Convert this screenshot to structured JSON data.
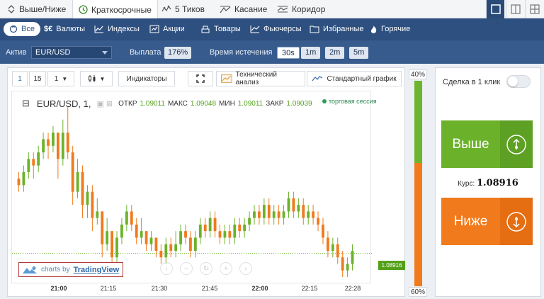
{
  "top_tabs": [
    {
      "label": "Выше/Ниже",
      "icon": "updown-icon"
    },
    {
      "label": "Краткосрочные",
      "icon": "clock-icon"
    },
    {
      "label": "5 Тиков",
      "icon": "ticks-icon"
    },
    {
      "label": "Касание",
      "icon": "touch-icon"
    },
    {
      "label": "Коридор",
      "icon": "corridor-icon"
    }
  ],
  "categories": [
    {
      "label": "Все",
      "icon": "all-icon"
    },
    {
      "label": "Валюты",
      "icon": "currency-icon"
    },
    {
      "label": "Индексы",
      "icon": "index-icon"
    },
    {
      "label": "Акции",
      "icon": "stocks-icon"
    },
    {
      "label": "Товары",
      "icon": "commodities-icon"
    },
    {
      "label": "Фьючерсы",
      "icon": "futures-icon"
    },
    {
      "label": "Избранные",
      "icon": "favorites-icon"
    },
    {
      "label": "Горячие",
      "icon": "hot-icon"
    }
  ],
  "settings": {
    "asset_label": "Актив",
    "asset_value": "EUR/USD",
    "payout_label": "Выплата",
    "payout_value": "176%",
    "expiry_label": "Время истечения",
    "expiry_options": [
      "30s",
      "1m",
      "2m",
      "5m"
    ],
    "expiry_selected": "30s"
  },
  "chart_toolbar": {
    "interval_a": "1",
    "interval_b": "15",
    "interval_c": "1",
    "indicators": "Индикаторы",
    "tech_analysis": "Технический анализ",
    "standard_chart": "Стандартный график"
  },
  "chart_legend": {
    "symbol": "EUR/USD, 1,",
    "open_label": "ОТКР",
    "open": "1.09011",
    "high_label": "МАКС",
    "high": "1.09048",
    "low_label": "МИН",
    "low": "1.09011",
    "close_label": "ЗАКР",
    "close": "1.09039",
    "session": "торговая сессия"
  },
  "current_price": "1.08916",
  "tv_badge": {
    "prefix": "charts by",
    "brand": "TradingView"
  },
  "sentiment": {
    "up_label": "40%",
    "down_label": "60%",
    "up_color": "#6db52e",
    "down_color": "#f07a1c"
  },
  "trade": {
    "one_click": "Сделка в 1 клик",
    "up_label": "Выше",
    "down_label": "Ниже",
    "rate_label": "Курс:",
    "rate_value": "1.08916"
  },
  "colors": {
    "bull": "#6bb22a",
    "bear": "#f07a1c",
    "nav": "#2e5080"
  },
  "chart_data": {
    "type": "candlestick",
    "x_ticks": [
      "21:00",
      "21:15",
      "21:30",
      "21:45",
      "22:00",
      "22:15",
      "22:28"
    ],
    "bold_ticks": [
      "21:00",
      "22:00"
    ],
    "price_range": [
      1.0888,
      1.0915
    ],
    "last_price": 1.08916,
    "candles": [
      [
        1.0903,
        1.0902,
        1.0904,
        1.0901
      ],
      [
        1.0902,
        1.0904,
        1.0905,
        1.0901
      ],
      [
        1.0904,
        1.0906,
        1.0907,
        1.0903
      ],
      [
        1.0906,
        1.0905,
        1.0907,
        1.0903
      ],
      [
        1.0905,
        1.0907,
        1.0908,
        1.0904
      ],
      [
        1.0907,
        1.0909,
        1.091,
        1.0906
      ],
      [
        1.0909,
        1.0908,
        1.091,
        1.0906
      ],
      [
        1.0908,
        1.091,
        1.0911,
        1.0907
      ],
      [
        1.091,
        1.0906,
        1.091,
        1.0903
      ],
      [
        1.0906,
        1.091,
        1.0912,
        1.0905
      ],
      [
        1.091,
        1.0907,
        1.0914,
        1.0906
      ],
      [
        1.0907,
        1.0901,
        1.0908,
        1.0899
      ],
      [
        1.0901,
        1.0904,
        1.0906,
        1.09
      ],
      [
        1.0904,
        1.0899,
        1.0905,
        1.0897
      ],
      [
        1.0899,
        1.0901,
        1.0902,
        1.0897
      ],
      [
        1.0901,
        1.0897,
        1.0902,
        1.0895
      ],
      [
        1.0897,
        1.0898,
        1.09,
        1.0896
      ],
      [
        1.0898,
        1.0893,
        1.0898,
        1.0891
      ],
      [
        1.0893,
        1.0895,
        1.0897,
        1.0892
      ],
      [
        1.0895,
        1.0891,
        1.0895,
        1.089
      ],
      [
        1.0891,
        1.0894,
        1.0895,
        1.089
      ],
      [
        1.0894,
        1.0896,
        1.0897,
        1.0893
      ],
      [
        1.0896,
        1.0898,
        1.0899,
        1.0895
      ],
      [
        1.0898,
        1.0896,
        1.0899,
        1.0895
      ],
      [
        1.0896,
        1.0894,
        1.0897,
        1.0893
      ],
      [
        1.0894,
        1.0895,
        1.0897,
        1.0893
      ],
      [
        1.0895,
        1.0893,
        1.0895,
        1.0892
      ],
      [
        1.0893,
        1.0894,
        1.0895,
        1.0892
      ],
      [
        1.0894,
        1.0892,
        1.0894,
        1.0891
      ],
      [
        1.0892,
        1.0891,
        1.0893,
        1.089
      ],
      [
        1.0891,
        1.0893,
        1.0894,
        1.089
      ],
      [
        1.0893,
        1.0892,
        1.0894,
        1.0891
      ],
      [
        1.0892,
        1.0893,
        1.0895,
        1.0891
      ],
      [
        1.0893,
        1.0895,
        1.0896,
        1.0892
      ],
      [
        1.0895,
        1.0894,
        1.0896,
        1.0893
      ],
      [
        1.0894,
        1.0892,
        1.0895,
        1.0891
      ],
      [
        1.0892,
        1.0894,
        1.0895,
        1.0891
      ],
      [
        1.0894,
        1.0896,
        1.0897,
        1.0893
      ],
      [
        1.0896,
        1.0895,
        1.0897,
        1.0894
      ],
      [
        1.0895,
        1.0897,
        1.0898,
        1.0894
      ],
      [
        1.0897,
        1.0895,
        1.0898,
        1.0894
      ],
      [
        1.0895,
        1.0894,
        1.0896,
        1.0893
      ],
      [
        1.0894,
        1.0895,
        1.0896,
        1.0893
      ],
      [
        1.0895,
        1.0894,
        1.0896,
        1.0893
      ],
      [
        1.0894,
        1.0896,
        1.0897,
        1.0893
      ],
      [
        1.0896,
        1.0895,
        1.0897,
        1.0894
      ],
      [
        1.0895,
        1.0896,
        1.0897,
        1.0894
      ],
      [
        1.0896,
        1.0897,
        1.0898,
        1.0895
      ],
      [
        1.0897,
        1.0898,
        1.0899,
        1.0896
      ],
      [
        1.0898,
        1.0897,
        1.0899,
        1.0896
      ],
      [
        1.0897,
        1.0899,
        1.09,
        1.0896
      ],
      [
        1.0899,
        1.0897,
        1.09,
        1.0896
      ],
      [
        1.0897,
        1.0898,
        1.0899,
        1.0896
      ],
      [
        1.0898,
        1.0897,
        1.0899,
        1.0896
      ],
      [
        1.0897,
        1.0898,
        1.0899,
        1.0896
      ],
      [
        1.0898,
        1.09,
        1.0901,
        1.0897
      ],
      [
        1.09,
        1.0898,
        1.0901,
        1.0897
      ],
      [
        1.0898,
        1.0899,
        1.09,
        1.0897
      ],
      [
        1.0899,
        1.0897,
        1.09,
        1.0896
      ],
      [
        1.0897,
        1.0898,
        1.0899,
        1.0896
      ],
      [
        1.0898,
        1.0897,
        1.0899,
        1.0896
      ],
      [
        1.0897,
        1.0896,
        1.0898,
        1.0895
      ],
      [
        1.0896,
        1.0894,
        1.0897,
        1.0893
      ],
      [
        1.0894,
        1.0892,
        1.0895,
        1.0891
      ],
      [
        1.0892,
        1.0893,
        1.0894,
        1.0891
      ],
      [
        1.0893,
        1.0891,
        1.0894,
        1.089
      ],
      [
        1.0891,
        1.0889,
        1.0892,
        1.0888
      ],
      [
        1.0889,
        1.089,
        1.0891,
        1.0888
      ],
      [
        1.089,
        1.0892,
        1.0893,
        1.0889
      ]
    ]
  }
}
